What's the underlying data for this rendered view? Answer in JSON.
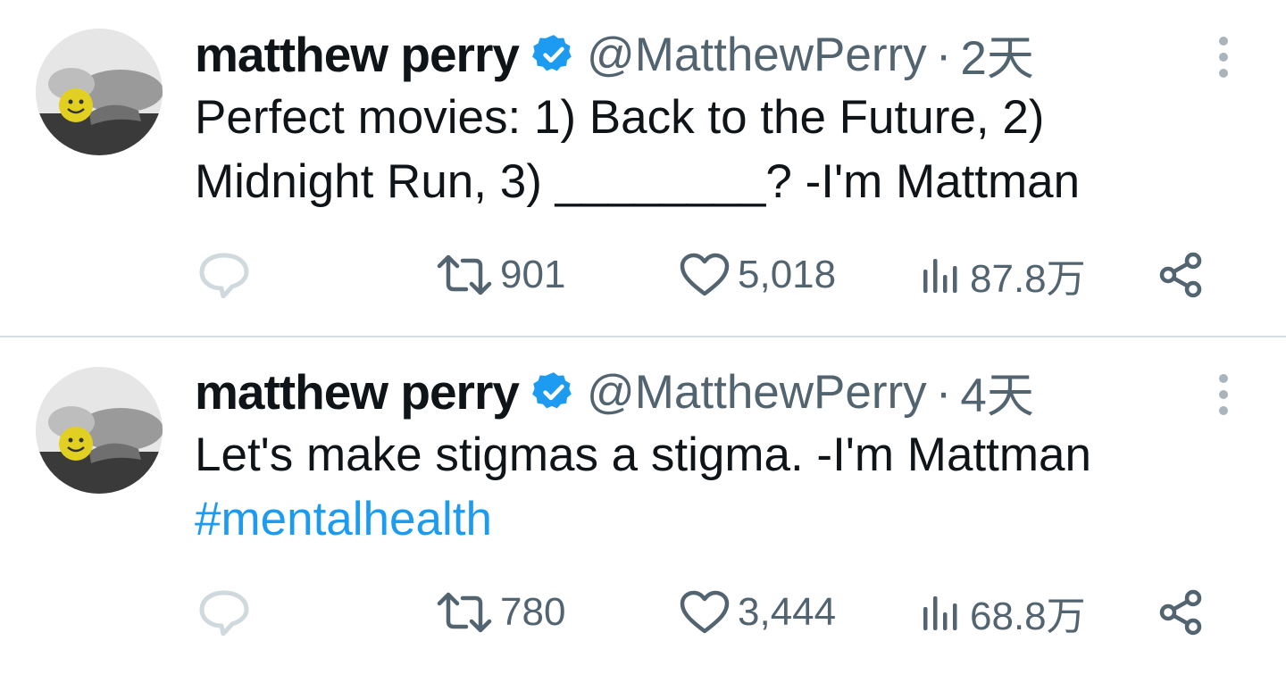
{
  "tweets": [
    {
      "author_name": "matthew perry",
      "handle": "@MatthewPerry",
      "separator": "·",
      "time": "2天",
      "text": "Perfect movies: 1) Back to the Future, 2) Midnight Run, 3) ________? -I'm Mattman",
      "hashtag": "",
      "retweets": "901",
      "likes": "5,018",
      "views": "87.8万"
    },
    {
      "author_name": "matthew perry",
      "handle": "@MatthewPerry",
      "separator": "·",
      "time": "4天",
      "text": "Let's make stigmas a stigma. -I'm Mattman",
      "hashtag": "#mentalhealth",
      "retweets": "780",
      "likes": "3,444",
      "views": "68.8万"
    }
  ],
  "icons": {
    "verified": "verified-badge-icon",
    "more": "more-vertical-icon",
    "reply": "reply-icon",
    "retweet": "retweet-icon",
    "like": "heart-icon",
    "views": "views-icon",
    "share": "share-icon"
  },
  "colors": {
    "text": "#0f1419",
    "secondary": "#536471",
    "accent": "#1d9bf0",
    "divider": "#d8dde1"
  }
}
